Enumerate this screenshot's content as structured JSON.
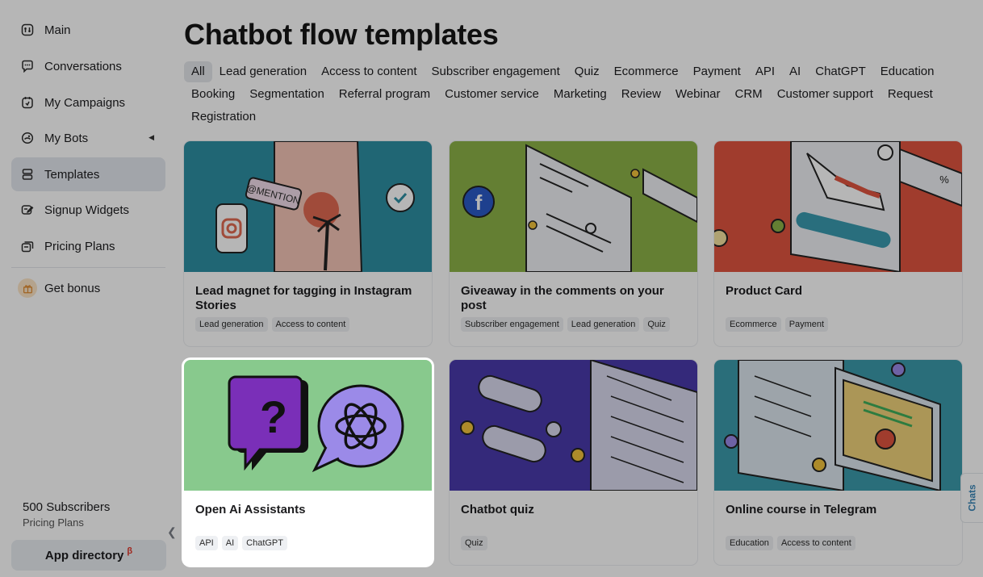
{
  "sidebar": {
    "items": [
      {
        "label": "Main",
        "icon": "home-icon"
      },
      {
        "label": "Conversations",
        "icon": "chat-icon"
      },
      {
        "label": "My Campaigns",
        "icon": "campaign-icon"
      },
      {
        "label": "My Bots",
        "icon": "bot-icon"
      },
      {
        "label": "Templates",
        "icon": "templates-icon",
        "active": true
      },
      {
        "label": "Signup Widgets",
        "icon": "widget-icon"
      },
      {
        "label": "Pricing Plans",
        "icon": "pricing-icon"
      }
    ],
    "bonus_label": "Get bonus",
    "subscribers": "500 Subscribers",
    "plan": "Pricing Plans",
    "app_directory": "App directory",
    "beta": "β"
  },
  "page_title": "Chatbot flow templates",
  "filters": [
    "All",
    "Lead generation",
    "Access to content",
    "Subscriber engagement",
    "Quiz",
    "Ecommerce",
    "Payment",
    "API",
    "AI",
    "ChatGPT",
    "Education",
    "Booking",
    "Segmentation",
    "Referral program",
    "Customer service",
    "Marketing",
    "Review",
    "Webinar",
    "CRM",
    "Customer support",
    "Request",
    "Registration"
  ],
  "active_filter": "All",
  "cards": [
    {
      "title": "Lead magnet for tagging in Instagram Stories",
      "tags": [
        "Lead generation",
        "Access to content"
      ],
      "bg": "#2e8fa3",
      "art_text": "@MENTION"
    },
    {
      "title": "Giveaway in the comments on your post",
      "tags": [
        "Subscriber engagement",
        "Lead generation",
        "Quiz"
      ],
      "bg": "#8cb248"
    },
    {
      "title": "Product Card",
      "tags": [
        "Ecommerce",
        "Payment"
      ],
      "bg": "#e0543f",
      "art_text": "%"
    },
    {
      "title": "Open Ai Assistants",
      "tags": [
        "API",
        "AI",
        "ChatGPT"
      ],
      "bg": "#88c98d",
      "highlighted": true
    },
    {
      "title": "Chatbot quiz",
      "tags": [
        "Quiz"
      ],
      "bg": "#4a3aab"
    },
    {
      "title": "Online course in Telegram",
      "tags": [
        "Education",
        "Access to content"
      ],
      "bg": "#3c9aab"
    }
  ],
  "chats_tab": "Chats",
  "colors": {
    "overlay": "rgba(0,0,0,0.285)",
    "accent": "#3b87b8",
    "beta": "#e0372a"
  }
}
